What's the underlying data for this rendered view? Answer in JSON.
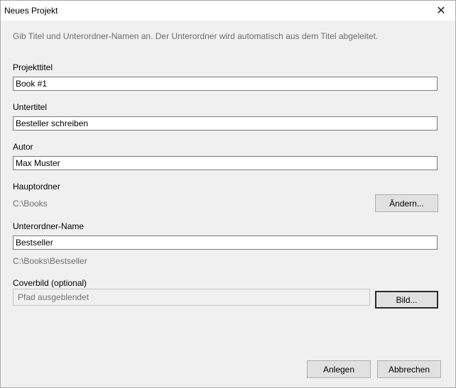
{
  "window": {
    "title": "Neues Projekt",
    "close_glyph": "✕"
  },
  "intro": "Gib Titel und Unterordner-Namen an. Der Unterordner wird automatisch aus dem Titel abgeleitet.",
  "fields": {
    "title_label": "Projekttitel",
    "title_value": "Book #1",
    "subtitle_label": "Untertitel",
    "subtitle_value": "Besteller schreiben",
    "author_label": "Autor",
    "author_value": "Max Muster",
    "main_folder_label": "Hauptordner",
    "main_folder_value": "C:\\Books",
    "change_button": "Ändern...",
    "subfolder_label": "Unterordner-Name",
    "subfolder_value": "Bestseller",
    "subfolder_path": "C:\\Books\\Bestseller",
    "cover_label": "Coverbild (optional)",
    "cover_placeholder": "Pfad ausgeblendet",
    "cover_button": "Bild..."
  },
  "actions": {
    "create": "Anlegen",
    "cancel": "Abbrechen"
  }
}
